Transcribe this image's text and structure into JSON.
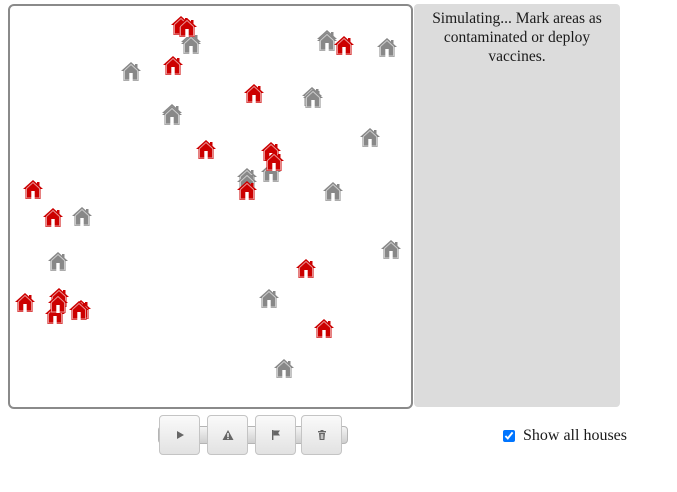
{
  "status": {
    "message": "Simulating... Mark areas as contaminated or deploy vaccines."
  },
  "colors": {
    "infected_house": "#cc0000",
    "healthy_house": "#888888",
    "panel_background": "#dcdcdc"
  },
  "houses": {
    "infected_count": 19,
    "healthy_count": 20
  },
  "toolbar": {
    "play_icon": "play-icon",
    "contaminate_icon": "warning-icon",
    "vaccinate_icon": "flag-icon",
    "clear_icon": "trash-icon"
  },
  "show_all_houses": {
    "label": "Show all houses",
    "checked": true
  }
}
